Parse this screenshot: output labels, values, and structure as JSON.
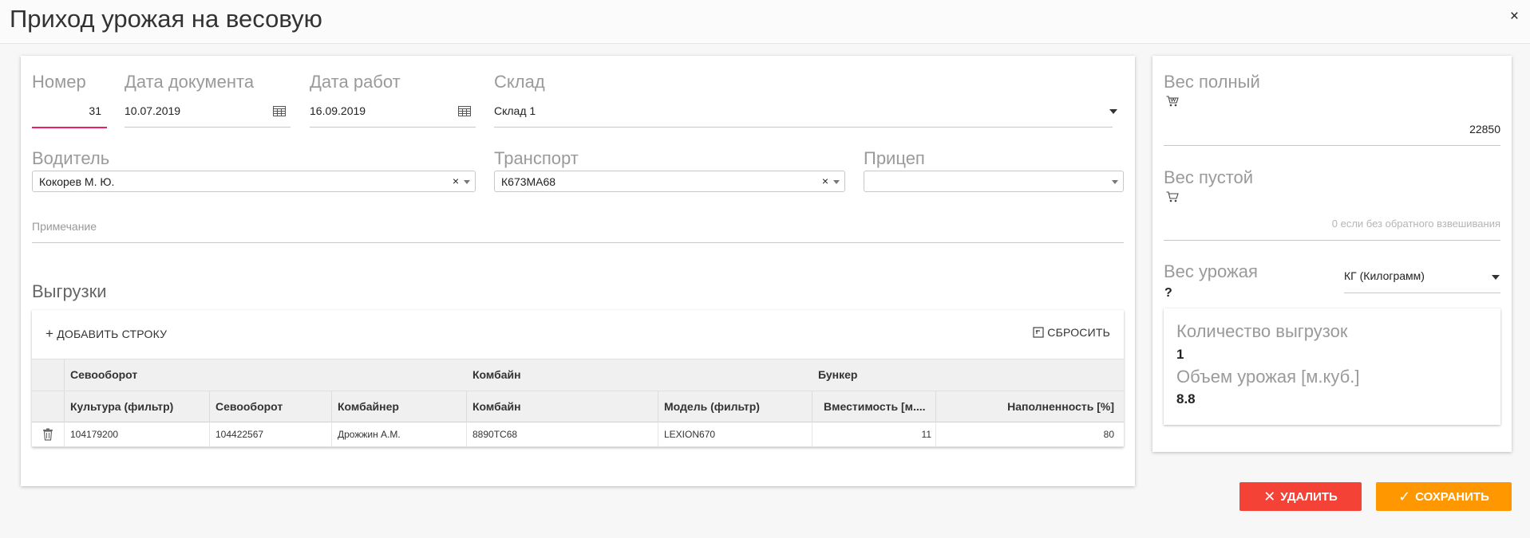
{
  "window": {
    "title": "Приход урожая на весовую",
    "close": "×"
  },
  "fields": {
    "number": {
      "label": "Номер",
      "value": "31"
    },
    "doc_date": {
      "label": "Дата документа",
      "value": "10.07.2019"
    },
    "work_date": {
      "label": "Дата работ",
      "value": "16.09.2019"
    },
    "warehouse": {
      "label": "Склад",
      "value": "Склад 1"
    },
    "driver": {
      "label": "Водитель",
      "value": "Кокорев М. Ю.",
      "clear": "×"
    },
    "transport": {
      "label": "Транспорт",
      "value": "К673МА68",
      "clear": "×"
    },
    "trailer": {
      "label": "Прицеп",
      "value": ""
    },
    "note": {
      "label": "Примечание",
      "value": ""
    }
  },
  "unloads": {
    "title": "Выгрузки",
    "add_row": "ДОБАВИТЬ СТРОКУ",
    "reset": "СБРОСИТЬ",
    "group_headers": [
      "Севооборот",
      "Комбайн",
      "Бункер"
    ],
    "columns": [
      "Культура (фильтр)",
      "Севооборот",
      "Комбайнер",
      "Комбайн",
      "Модель (фильтр)",
      "Вместимость [м....",
      "Наполненность [%]"
    ],
    "rows": [
      [
        "104179200",
        "104422567",
        "Дрожжин А.М.",
        "8890ТС68",
        "LEXION670",
        "11",
        "80"
      ]
    ]
  },
  "weights": {
    "full": {
      "label": "Вес полный",
      "value": "22850"
    },
    "empty": {
      "label": "Вес пустой",
      "placeholder": "0 если без обратного взвешивания"
    },
    "harvest": {
      "label": "Вес урожая",
      "value": "?",
      "unit": "КГ (Килограмм)"
    }
  },
  "summary": {
    "count_label": "Количество выгрузок",
    "count_value": "1",
    "volume_label": "Объем урожая [м.куб.]",
    "volume_value": "8.8"
  },
  "actions": {
    "delete": "УДАЛИТЬ",
    "save": "СОХРАНИТЬ"
  },
  "colors": {
    "accent": "#e91e63",
    "delete": "#f44336",
    "save": "#ff9800"
  }
}
